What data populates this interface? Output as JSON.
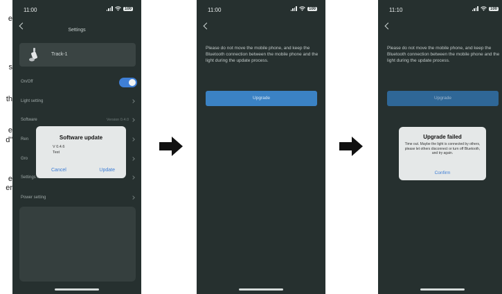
{
  "edge_text": [
    "e",
    "s",
    "th",
    "e",
    "d”",
    "e",
    "er"
  ],
  "phone1": {
    "time": "11:00",
    "battery": "100",
    "title": "Settings",
    "device_name": "Track-1",
    "rows": [
      {
        "label": "On/Off",
        "value": ""
      },
      {
        "label": "Light setting",
        "value": ""
      },
      {
        "label": "Software",
        "value": "Version 0.4.0"
      },
      {
        "label": "Ren",
        "value": ""
      },
      {
        "label": "Gro",
        "value": ""
      },
      {
        "label": "Settings Rese",
        "value": ""
      },
      {
        "label": "Power setting",
        "value": ""
      }
    ],
    "dialog": {
      "title": "Software update",
      "version": "V 0.4.6",
      "note": "Test",
      "cancel": "Cancel",
      "update": "Update"
    }
  },
  "phone2": {
    "time": "11:00",
    "battery": "100",
    "instructions": "Please do not move the mobile phone, and keep the Bluetooth connection between the mobile phone and the light during the update process.",
    "upgrade_label": "Upgrade"
  },
  "phone3": {
    "time": "11:10",
    "battery": "100",
    "instructions": "Please do not move the mobile phone, and keep the Bluetooth connection between the mobile phone and the light during the update process.",
    "upgrade_label": "Upgrade",
    "dialog": {
      "title": "Upgrade failed",
      "message": "Time out. Maybe the light is connected by others, please let others disconnect or turn off Bluetooth, and try again.",
      "confirm": "Confirm"
    }
  },
  "colors": {
    "screen_bg": "#26302f",
    "accent": "#3f7fd6",
    "dialog_bg": "#e5e8e8"
  }
}
